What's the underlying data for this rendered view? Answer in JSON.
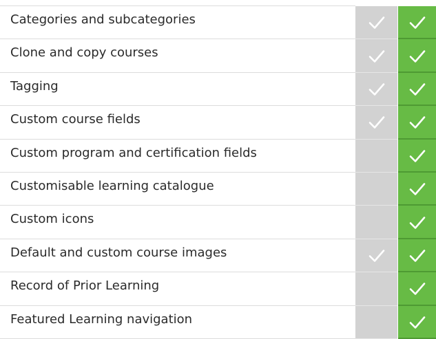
{
  "icon_name": "check-icon",
  "colors": {
    "gray_column": "#d2d2d2",
    "green_column": "#67bb45",
    "check": "#ffffff"
  },
  "features": [
    {
      "label": "Categories and subcategories",
      "gray_check": true,
      "green_check": true
    },
    {
      "label": "Clone and copy courses",
      "gray_check": true,
      "green_check": true
    },
    {
      "label": "Tagging",
      "gray_check": true,
      "green_check": true
    },
    {
      "label": "Custom course fields",
      "gray_check": true,
      "green_check": true
    },
    {
      "label": "Custom program and certification fields",
      "gray_check": false,
      "green_check": true
    },
    {
      "label": "Customisable learning catalogue",
      "gray_check": false,
      "green_check": true
    },
    {
      "label": "Custom icons",
      "gray_check": false,
      "green_check": true
    },
    {
      "label": "Default and custom course images",
      "gray_check": true,
      "green_check": true
    },
    {
      "label": "Record of Prior Learning",
      "gray_check": false,
      "green_check": true
    },
    {
      "label": "Featured Learning navigation",
      "gray_check": false,
      "green_check": true
    }
  ]
}
